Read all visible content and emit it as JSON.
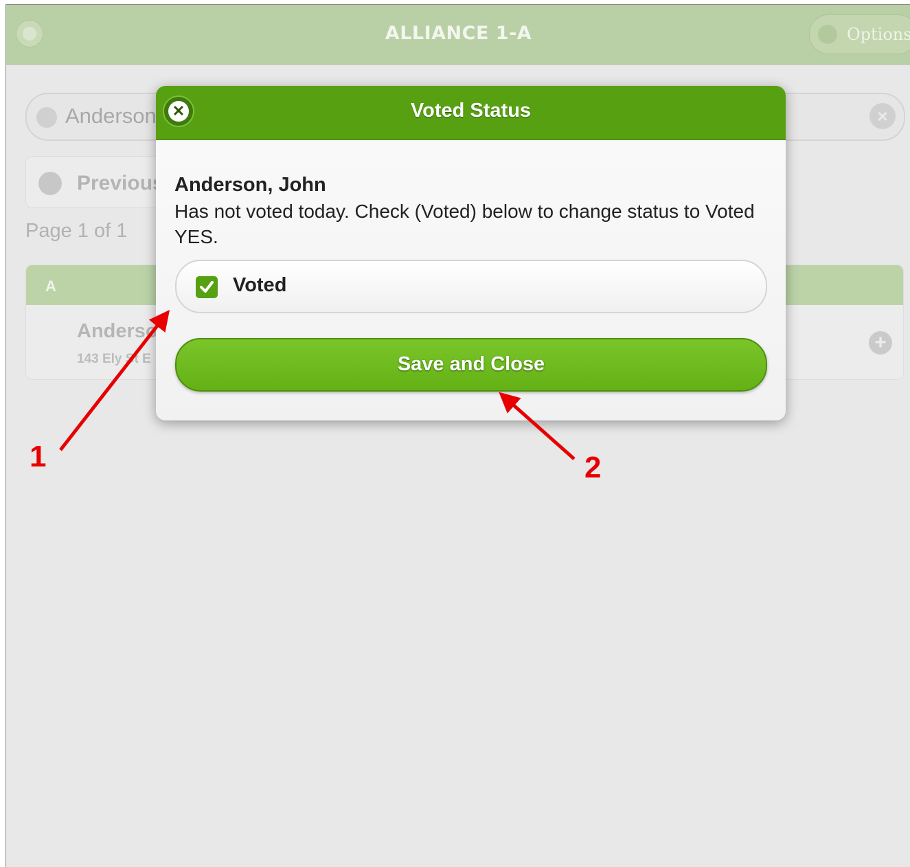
{
  "header": {
    "title": "ALLIANCE 1-A",
    "options_label": "Options"
  },
  "search": {
    "value": "Anderson",
    "clear_icon": "x-icon"
  },
  "pager": {
    "previous_label": "Previous",
    "page_info": "Page 1 of 1"
  },
  "list": {
    "divider": "A",
    "item": {
      "name": "Anderson",
      "address": "143 Ely St E"
    }
  },
  "dialog": {
    "title": "Voted Status",
    "voter_name": "Anderson, John",
    "message": "Has not voted today. Check (Voted) below to change status to Voted YES.",
    "checkbox_label": "Voted",
    "checkbox_checked": true,
    "save_label": "Save and Close"
  },
  "annotations": {
    "step1": "1",
    "step2": "2"
  },
  "colors": {
    "accent_green": "#56a011",
    "button_green": "#6cb81d",
    "annotation_red": "#e60000"
  }
}
